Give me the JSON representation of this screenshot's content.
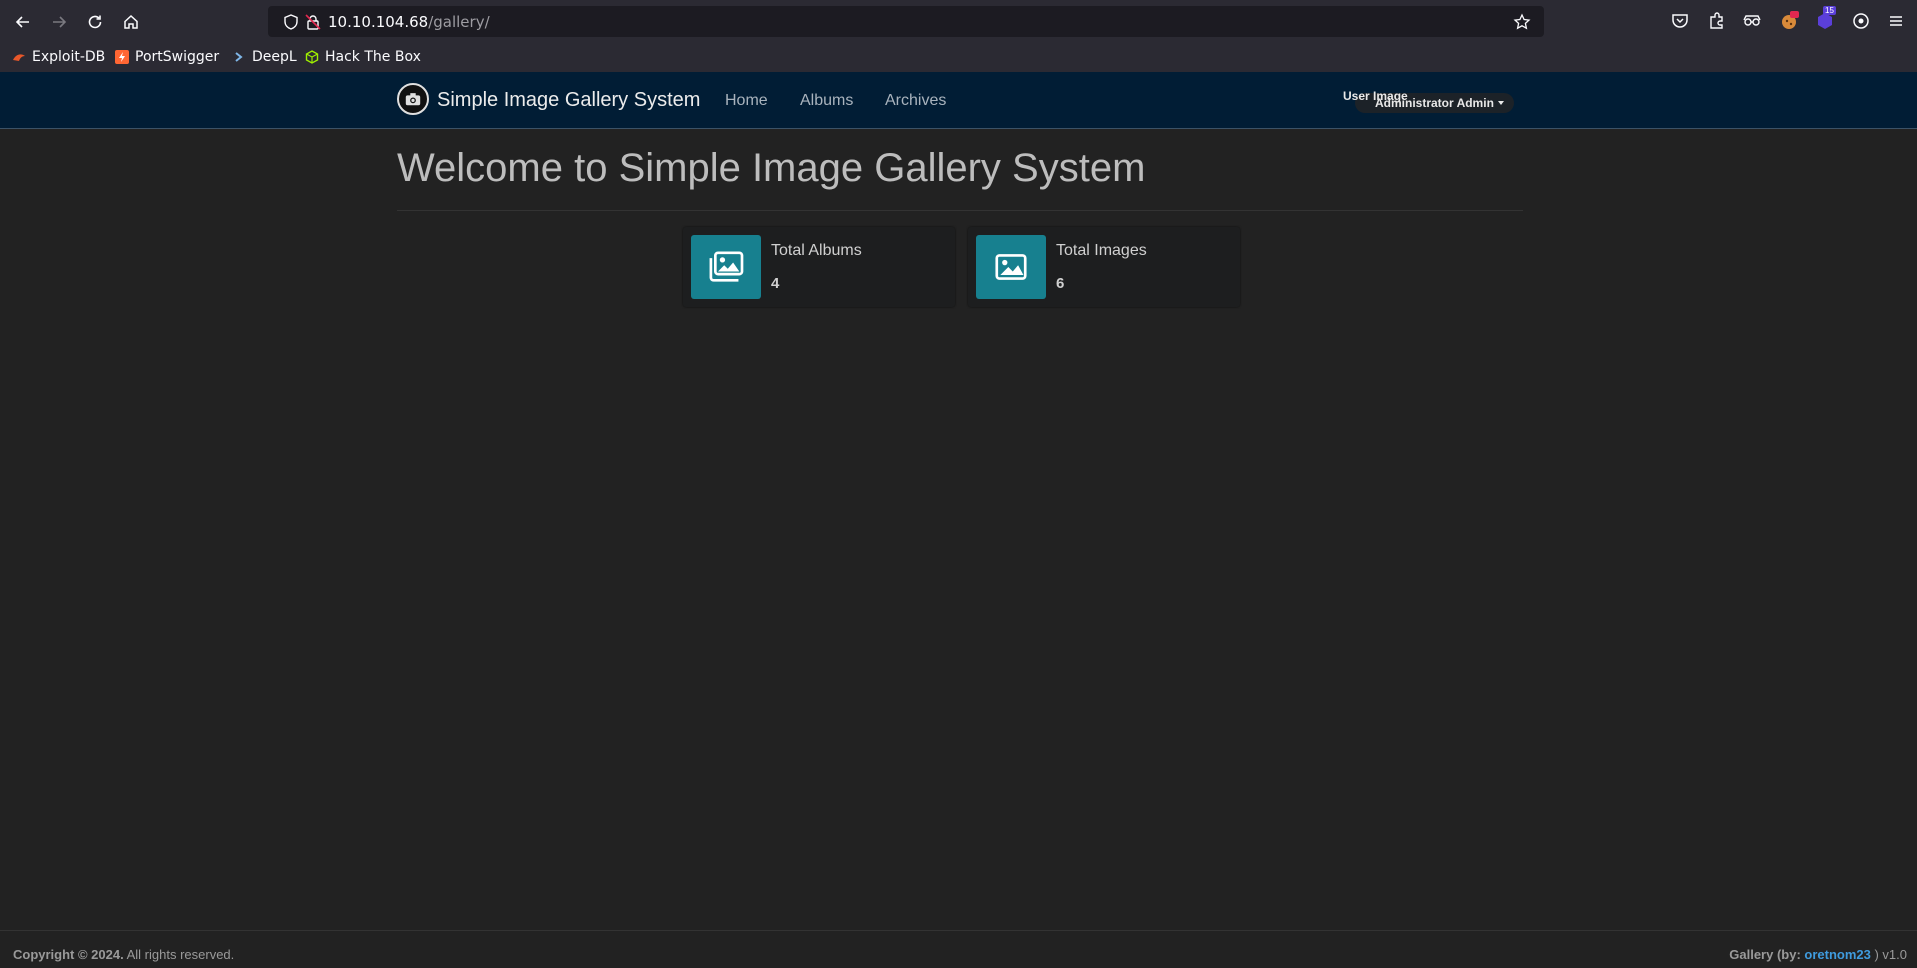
{
  "browser": {
    "url_host": "10.10.104.68",
    "url_path": "/gallery/",
    "bookmarks": [
      {
        "label": "Exploit-DB",
        "icon": "exploit-db-icon",
        "color": "#e8572a"
      },
      {
        "label": "PortSwigger",
        "icon": "portswigger-icon",
        "color": "#ff6633"
      },
      {
        "label": "DeepL",
        "icon": "deepl-icon",
        "color": "#7fb6e8"
      },
      {
        "label": "Hack The Box",
        "icon": "hackthebox-icon",
        "color": "#9fef00"
      }
    ],
    "extension_badge": "15"
  },
  "navbar": {
    "brand": "Simple Image Gallery System",
    "links": [
      "Home",
      "Albums",
      "Archives"
    ],
    "user_image_alt": "User Image",
    "user_name": "Administrator Admin"
  },
  "main": {
    "title": "Welcome to Simple Image Gallery System",
    "cards": [
      {
        "label": "Total Albums",
        "value": "4",
        "icon": "albums-icon"
      },
      {
        "label": "Total Images",
        "value": "6",
        "icon": "image-icon"
      }
    ]
  },
  "footer": {
    "copyright_bold": "Copyright © 2024.",
    "copyright_rest": " All rights reserved.",
    "credit_prefix": "Gallery (by: ",
    "credit_author": "oretnom23",
    "credit_suffix": " ) v1.0"
  },
  "colors": {
    "navbar_bg": "#011d35",
    "card_icon_bg": "#17808f",
    "link_accent": "#3f9bde"
  }
}
